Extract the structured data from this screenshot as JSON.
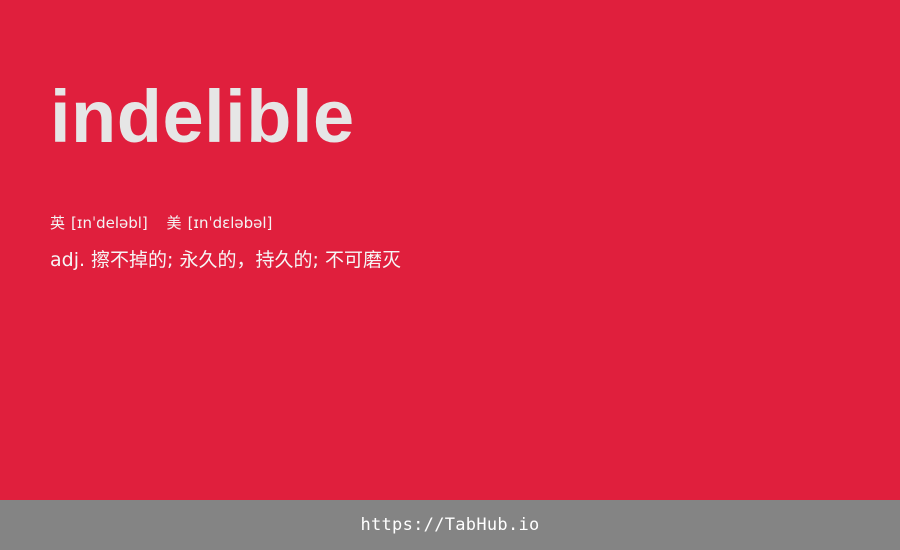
{
  "card": {
    "word": "indelible",
    "phonetics": {
      "uk": {
        "region": "英",
        "ipa": "[ɪnˈdeləbl]"
      },
      "us": {
        "region": "美",
        "ipa": "[ɪnˈdɛləbəl]"
      }
    },
    "definition": "adj. 擦不掉的; 永久的，持久的; 不可磨灭"
  },
  "footer": {
    "url": "https://TabHub.io"
  },
  "colors": {
    "background": "#e01f3d",
    "headword": "#e6e6e6",
    "footer_background": "#848484"
  }
}
